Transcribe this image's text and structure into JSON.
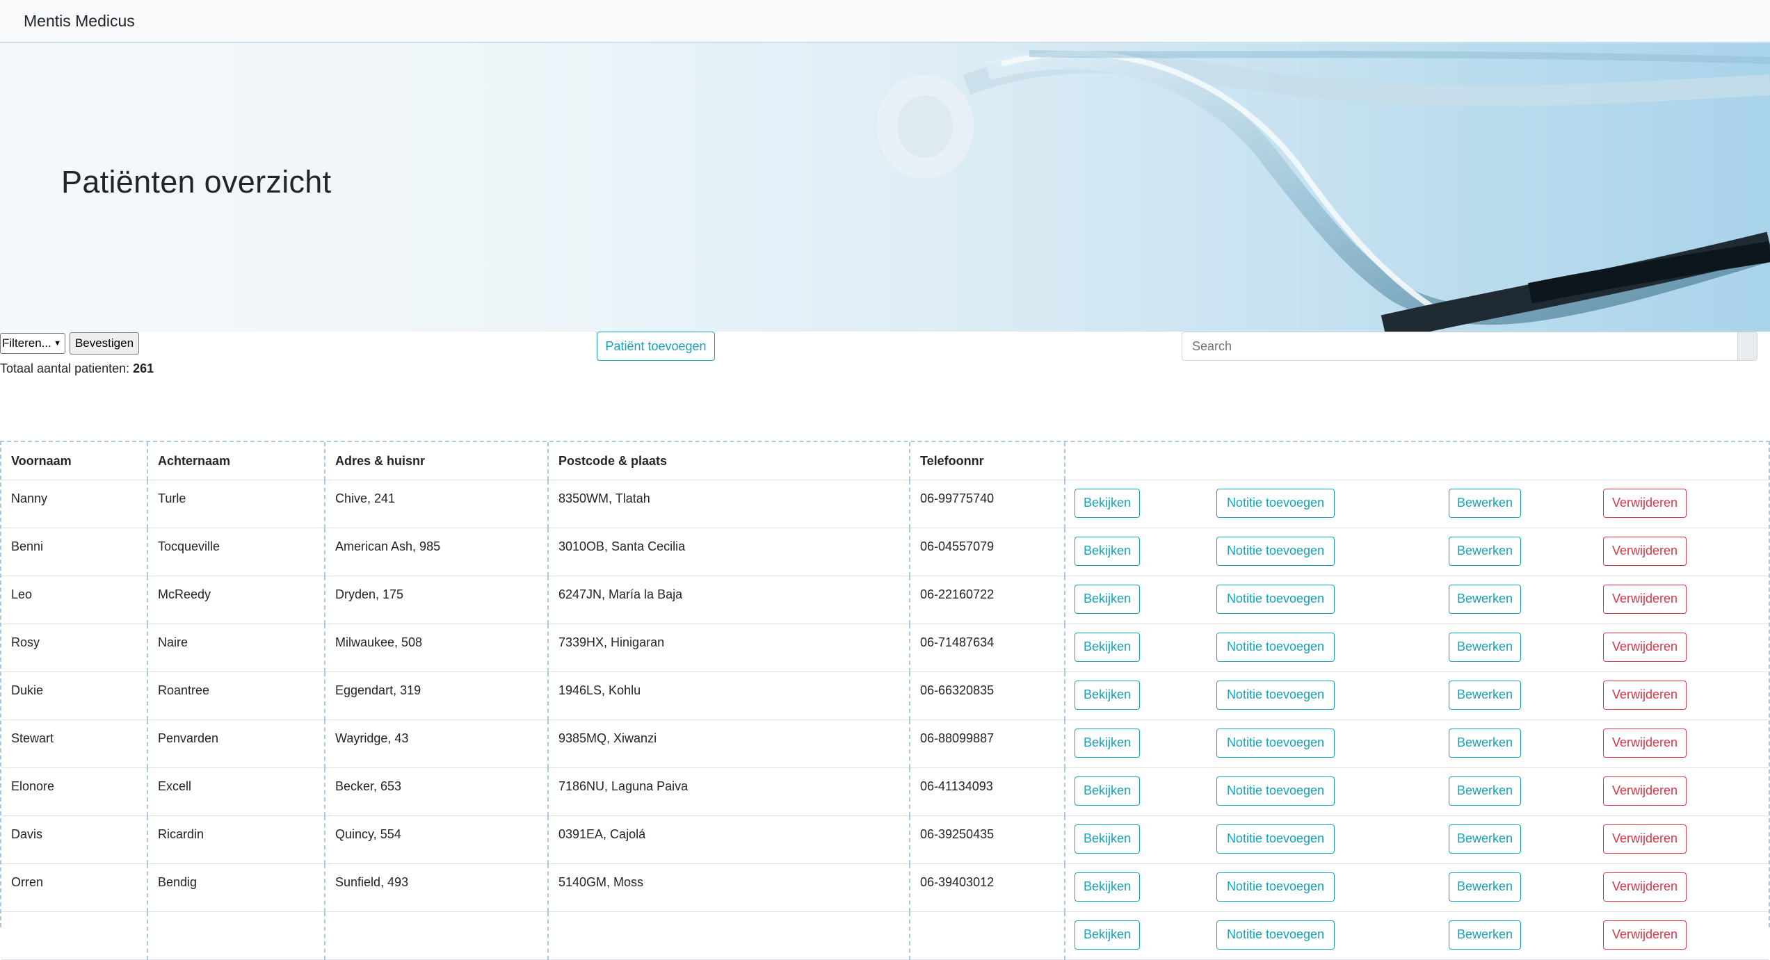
{
  "navbar": {
    "brand": "Mentis Medicus"
  },
  "hero": {
    "title": "Patiënten overzicht"
  },
  "controls": {
    "filter_selected": "Filteren...",
    "confirm_label": "Bevestigen",
    "total_label": "Totaal aantal patienten: ",
    "total_value": "261",
    "add_patient_label": "Patiënt toevoegen",
    "search_placeholder": "Search"
  },
  "table": {
    "headers": [
      "Voornaam",
      "Achternaam",
      "Adres & huisnr",
      "Postcode & plaats",
      "Telefoonnr",
      ""
    ],
    "actions": {
      "view": "Bekijken",
      "note": "Notitie toevoegen",
      "edit": "Bewerken",
      "delete": "Verwijderen"
    },
    "rows": [
      {
        "first": "Nanny",
        "last": "Turle",
        "address": "Chive, 241",
        "postal": "8350WM, Tlatah",
        "phone": "06-99775740"
      },
      {
        "first": "Benni",
        "last": "Tocqueville",
        "address": "American Ash, 985",
        "postal": "3010OB, Santa Cecilia",
        "phone": "06-04557079"
      },
      {
        "first": "Leo",
        "last": "McReedy",
        "address": "Dryden, 175",
        "postal": "6247JN, María la Baja",
        "phone": "06-22160722"
      },
      {
        "first": "Rosy",
        "last": "Naire",
        "address": "Milwaukee, 508",
        "postal": "7339HX, Hinigaran",
        "phone": "06-71487634"
      },
      {
        "first": "Dukie",
        "last": "Roantree",
        "address": "Eggendart, 319",
        "postal": "1946LS, Kohlu",
        "phone": "06-66320835"
      },
      {
        "first": "Stewart",
        "last": "Penvarden",
        "address": "Wayridge, 43",
        "postal": "9385MQ, Xiwanzi",
        "phone": "06-88099887"
      },
      {
        "first": "Elonore",
        "last": "Excell",
        "address": "Becker, 653",
        "postal": "7186NU, Laguna Paiva",
        "phone": "06-41134093"
      },
      {
        "first": "Davis",
        "last": "Ricardin",
        "address": "Quincy, 554",
        "postal": "0391EA, Cajolá",
        "phone": "06-39250435"
      },
      {
        "first": "Orren",
        "last": "Bendig",
        "address": "Sunfield, 493",
        "postal": "5140GM, Moss",
        "phone": "06-39403012"
      },
      {
        "first": "",
        "last": "",
        "address": "",
        "postal": "",
        "phone": ""
      }
    ]
  },
  "colors": {
    "info": "#17a2b8",
    "danger": "#dc3545",
    "table_border": "#a8cbe3"
  }
}
